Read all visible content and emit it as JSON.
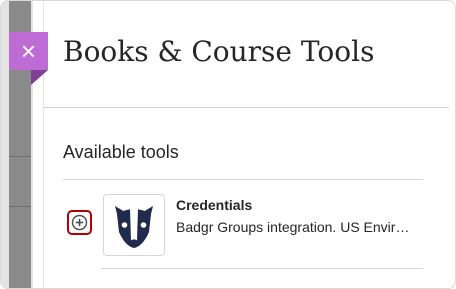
{
  "panel": {
    "title": "Books & Course Tools",
    "close_label": "×",
    "close_icon": "close-icon"
  },
  "section": {
    "heading": "Available tools"
  },
  "tools": [
    {
      "name": "Credentials",
      "description": "Badgr Groups integration. US Envir…",
      "logo_icon": "badger-logo-icon",
      "add_icon": "plus-circle-icon"
    }
  ],
  "colors": {
    "accent": "#bf6bd6",
    "add_button_border": "#b30000",
    "logo_dark": "#1f2a4d"
  }
}
